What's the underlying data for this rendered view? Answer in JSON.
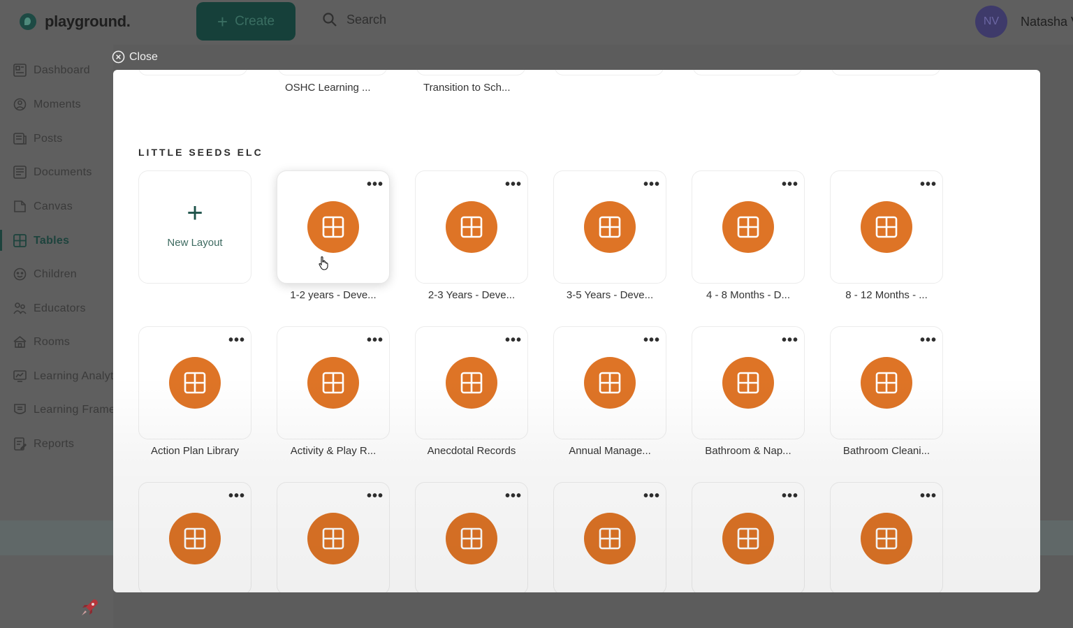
{
  "app": {
    "name": "playground."
  },
  "header": {
    "create_label": "Create",
    "search_placeholder": "Search",
    "user_initials": "NV",
    "user_name": "Natasha V"
  },
  "sidebar": {
    "items": [
      {
        "label": "Dashboard",
        "icon": "dashboard-icon"
      },
      {
        "label": "Moments",
        "icon": "moments-icon"
      },
      {
        "label": "Posts",
        "icon": "posts-icon"
      },
      {
        "label": "Documents",
        "icon": "documents-icon"
      },
      {
        "label": "Canvas",
        "icon": "canvas-icon"
      },
      {
        "label": "Tables",
        "icon": "tables-icon",
        "active": true
      },
      {
        "label": "Children",
        "icon": "children-icon"
      },
      {
        "label": "Educators",
        "icon": "educators-icon"
      },
      {
        "label": "Rooms",
        "icon": "rooms-icon"
      },
      {
        "label": "Learning Analytics",
        "icon": "learning-analytics-icon"
      },
      {
        "label": "Learning Frameworks",
        "icon": "learning-frameworks-icon"
      },
      {
        "label": "Reports",
        "icon": "reports-icon"
      }
    ]
  },
  "modal": {
    "close_label": "Close",
    "top_row": [
      "OSHC Learning ...",
      "Transition to Sch..."
    ],
    "section_title": "LITTLE SEEDS ELC",
    "new_layout_label": "New Layout",
    "row1": [
      "1-2 years - Deve...",
      "2-3 Years - Deve...",
      "3-5 Years - Deve...",
      "4 - 8 Months - D...",
      "8 - 12 Months - ..."
    ],
    "row2": [
      "Action Plan Library",
      "Activity & Play R...",
      "Anecdotal Records",
      "Annual Manage...",
      "Bathroom & Nap...",
      "Bathroom Cleani..."
    ],
    "more_label": "•••"
  },
  "colors": {
    "accent_orange": "#de7426",
    "brand_green": "#1d433d",
    "avatar_purple": "#3e3a6a"
  }
}
